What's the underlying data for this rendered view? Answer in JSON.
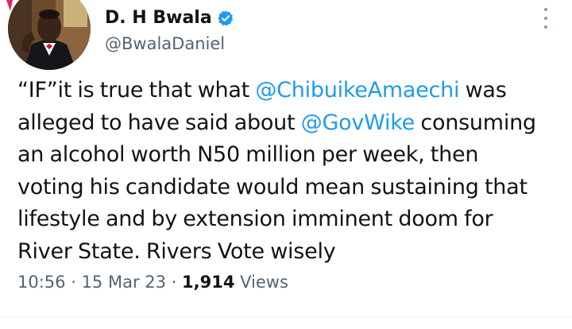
{
  "author": {
    "display_name": "D. H Bwala",
    "handle": "@BwalaDaniel",
    "verified_icon": "verified-badge-icon",
    "avatar_icon": "profile-photo"
  },
  "tweet": {
    "lines": [
      [
        {
          "t": "“IF”it is true that what "
        },
        {
          "t": "@ChibuikeAmaechi",
          "mention": true
        },
        {
          "t": " was"
        }
      ],
      [
        {
          "t": "alleged to have said about "
        },
        {
          "t": "@GovWike",
          "mention": true
        },
        {
          "t": " consuming"
        }
      ],
      [
        {
          "t": "an alcohol worth N50 million per week, then"
        }
      ],
      [
        {
          "t": "voting his candidate would mean sustaining that"
        }
      ],
      [
        {
          "t": "lifestyle and by extension imminent doom for"
        }
      ],
      [
        {
          "t": "River State. Rivers Vote wisely"
        }
      ]
    ]
  },
  "meta": {
    "time": "10:56",
    "separator": " · ",
    "date": "15 Mar 23",
    "views_count": "1,914",
    "views_label": " Views"
  },
  "colors": {
    "text": "#0f1419",
    "secondary": "#536471",
    "accent": "#1d9bf0"
  }
}
